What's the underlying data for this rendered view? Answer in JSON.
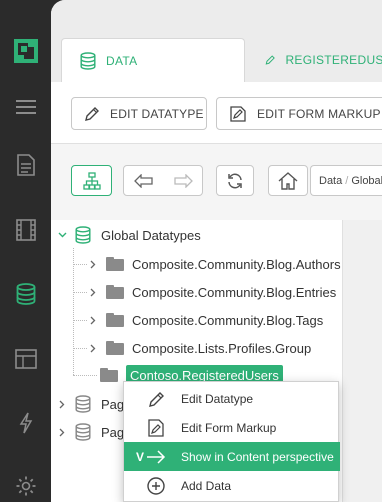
{
  "rail": {
    "items": [
      {
        "name": "composite-logo-icon"
      },
      {
        "name": "hamburger-menu-icon"
      },
      {
        "name": "content-perspective-icon"
      },
      {
        "name": "media-perspective-icon"
      },
      {
        "name": "data-perspective-icon"
      },
      {
        "name": "layout-perspective-icon"
      },
      {
        "name": "functions-perspective-icon"
      },
      {
        "name": "system-perspective-icon"
      }
    ],
    "active_color": "#2fb177"
  },
  "tabs": [
    {
      "label": "DATA"
    },
    {
      "label": "REGISTEREDUSER"
    }
  ],
  "toolbar": {
    "edit_datatype_label": "EDIT DATATYPE",
    "edit_form_markup_label": "EDIT FORM MARKUP"
  },
  "breadcrumb": {
    "part1": "Data",
    "sep": "/",
    "part2": "Global"
  },
  "tree": {
    "root": "Global Datatypes",
    "children": [
      "Composite.Community.Blog.Authors",
      "Composite.Community.Blog.Entries",
      "Composite.Community.Blog.Tags",
      "Composite.Lists.Profiles.Group",
      "Contoso.RegisteredUsers"
    ],
    "other_roots": [
      "Page",
      "Page"
    ]
  },
  "context_menu": {
    "items": [
      {
        "label": "Edit Datatype"
      },
      {
        "label": "Edit Form Markup"
      },
      {
        "label": "Show in Content perspective",
        "key": "V"
      },
      {
        "label": "Add Data"
      }
    ]
  },
  "colors": {
    "accent": "#2fb177",
    "rail_bg": "#2b2b2b"
  }
}
